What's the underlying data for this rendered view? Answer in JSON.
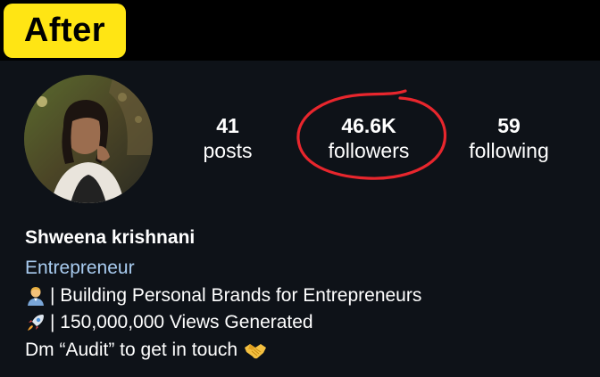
{
  "badge": {
    "label": "After"
  },
  "stats": {
    "posts": {
      "value": "41",
      "label": "posts"
    },
    "followers": {
      "value": "46.6K",
      "label": "followers"
    },
    "following": {
      "value": "59",
      "label": "following"
    }
  },
  "profile": {
    "name": "Shweena krishnani",
    "category": "Entrepreneur",
    "bio": [
      {
        "icon": "technologist-emoji",
        "text": "| Building Personal Brands for Entrepreneurs"
      },
      {
        "icon": "rocket-emoji",
        "text": "| 150,000,000 Views Generated"
      },
      {
        "icon": "handshake-emoji",
        "text": "Dm “Audit” to get in touch"
      }
    ]
  },
  "colors": {
    "badge": "#ffe514",
    "background": "#0e1218",
    "category": "#a9ccf0",
    "highlight_circle": "#e8262d"
  }
}
